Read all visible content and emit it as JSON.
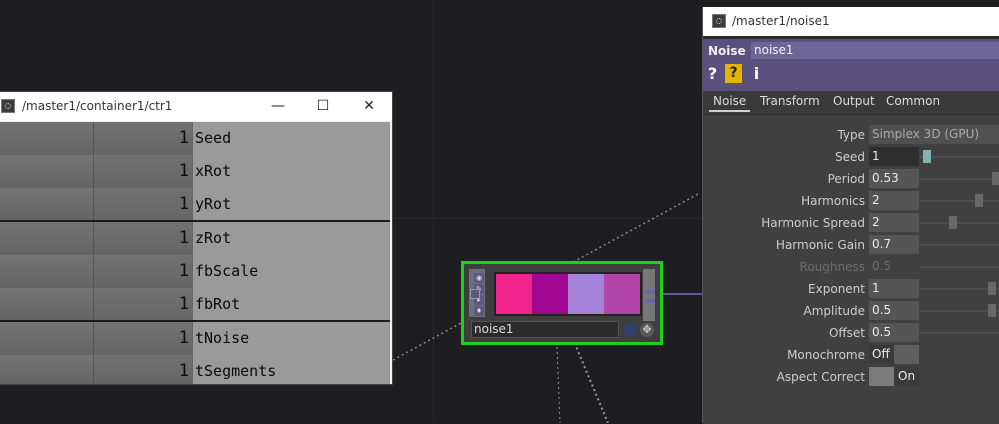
{
  "ctr_window": {
    "title": "/master1/container1/ctr1",
    "controls": {
      "minimize": "—",
      "maximize": "☐",
      "close": "✕"
    },
    "rows": [
      {
        "value": "1",
        "label": "Seed"
      },
      {
        "value": "1",
        "label": "xRot"
      },
      {
        "value": "1",
        "label": "yRot"
      },
      {
        "value": "1",
        "label": "zRot"
      },
      {
        "value": "1",
        "label": "fbScale"
      },
      {
        "value": "1",
        "label": "fbRot"
      },
      {
        "value": "1",
        "label": "tNoise"
      },
      {
        "value": "1",
        "label": "tSegments"
      }
    ]
  },
  "node": {
    "name": "noise1",
    "preview_colors": [
      "#f0248c",
      "#a0068f",
      "#a483d9",
      "#b145a9"
    ],
    "border_color": "#1dd11d"
  },
  "param_window": {
    "title": "/master1/noise1",
    "op_type": "Noise",
    "op_name": "noise1",
    "help": [
      "?",
      "?",
      "i"
    ],
    "tabs": [
      "Noise",
      "Transform",
      "Output",
      "Common"
    ],
    "active_tab": "Noise",
    "params": {
      "type": {
        "label": "Type",
        "value": "Simplex 3D (GPU)"
      },
      "seed": {
        "label": "Seed",
        "value": "1"
      },
      "period": {
        "label": "Period",
        "value": "0.53"
      },
      "harmonics": {
        "label": "Harmonics",
        "value": "2"
      },
      "harmonic_spread": {
        "label": "Harmonic Spread",
        "value": "2"
      },
      "harmonic_gain": {
        "label": "Harmonic Gain",
        "value": "0.7"
      },
      "roughness": {
        "label": "Roughness",
        "value": "0.5"
      },
      "exponent": {
        "label": "Exponent",
        "value": "1"
      },
      "amplitude": {
        "label": "Amplitude",
        "value": "0.5"
      },
      "offset": {
        "label": "Offset",
        "value": "0.5"
      },
      "monochrome": {
        "label": "Monochrome",
        "value": "Off"
      },
      "aspect_correct": {
        "label": "Aspect Correct",
        "value": "On"
      }
    }
  }
}
